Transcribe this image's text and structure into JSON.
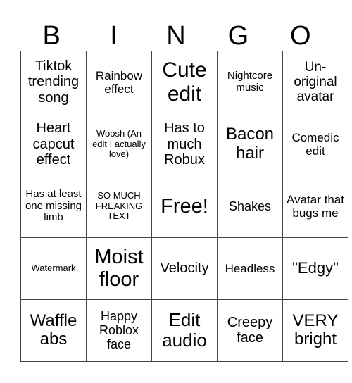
{
  "header": {
    "letters": [
      "B",
      "I",
      "N",
      "G",
      "O"
    ]
  },
  "board": {
    "rows": [
      [
        "Tiktok trending song",
        "Rainbow effect",
        "Cute edit",
        "Nightcore music",
        "Un-original avatar"
      ],
      [
        "Heart capcut effect",
        "Woosh (An edit I actually love)",
        "Has to much Robux",
        "Bacon hair",
        "Comedic edit"
      ],
      [
        "Has at least one missing limb",
        "SO MUCH FREAKING TEXT",
        "Free!",
        "Shakes",
        "Avatar that bugs me"
      ],
      [
        "Watermark",
        "Moist floor",
        "Velocity",
        "Headless",
        "\"Edgy\""
      ],
      [
        "Waffle abs",
        "Happy Roblox face",
        "Edit audio",
        "Creepy face",
        "VERY bright"
      ]
    ],
    "free_space": "Free!"
  },
  "colors": {
    "background": "#ffffff",
    "text": "#000000",
    "grid_line": "#444444"
  }
}
